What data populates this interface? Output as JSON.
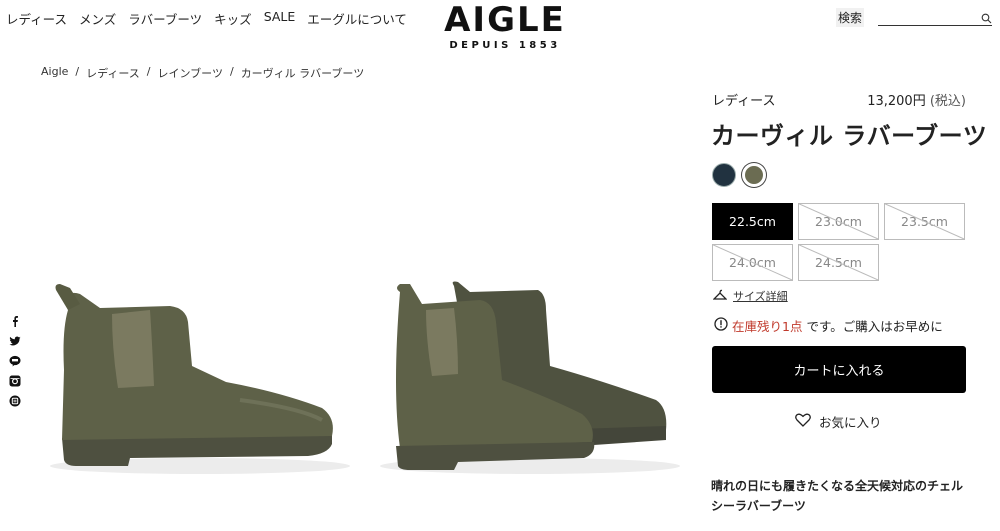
{
  "header": {
    "nav": [
      "レディース",
      "メンズ",
      "ラバーブーツ",
      "キッズ",
      "SALE",
      "エーグルについて"
    ],
    "logo_main": "AIGLE",
    "logo_sub": "DEPUIS 1853",
    "search_label": "検索",
    "search_placeholder": ""
  },
  "breadcrumb": [
    "Aigle",
    "レディース",
    "レインブーツ",
    "カーヴィル ラバーブーツ"
  ],
  "social_icons": [
    "facebook-icon",
    "twitter-icon",
    "line-icon",
    "instagram-icon",
    "share-icon"
  ],
  "product": {
    "category": "レディース",
    "price": "13,200円",
    "tax": "(税込)",
    "title": "カーヴィル ラバーブーツ",
    "colors": [
      {
        "name": "navy",
        "hex": "#213240"
      },
      {
        "name": "khaki",
        "hex": "#6b6c52",
        "selected": true
      }
    ],
    "sizes": [
      {
        "label": "22.5cm",
        "state": "selected"
      },
      {
        "label": "23.0cm",
        "state": "soldout"
      },
      {
        "label": "23.5cm",
        "state": "soldout"
      },
      {
        "label": "24.0cm",
        "state": "soldout"
      },
      {
        "label": "24.5cm",
        "state": "soldout"
      }
    ],
    "size_guide": "サイズ詳細",
    "stock_warning": "在庫残り1点",
    "stock_message": "です。ご購入はお早めに",
    "cart_button": "カートに入れる",
    "favorite": "お気に入り",
    "description": "晴れの日にも履きたくなる全天候対応のチェルシーラバーブーツ"
  },
  "colors": {
    "boot": "#5e6148",
    "boot_dark": "#4a4c38",
    "elastic": "#7b7a60",
    "accent_red": "#c0392b"
  }
}
